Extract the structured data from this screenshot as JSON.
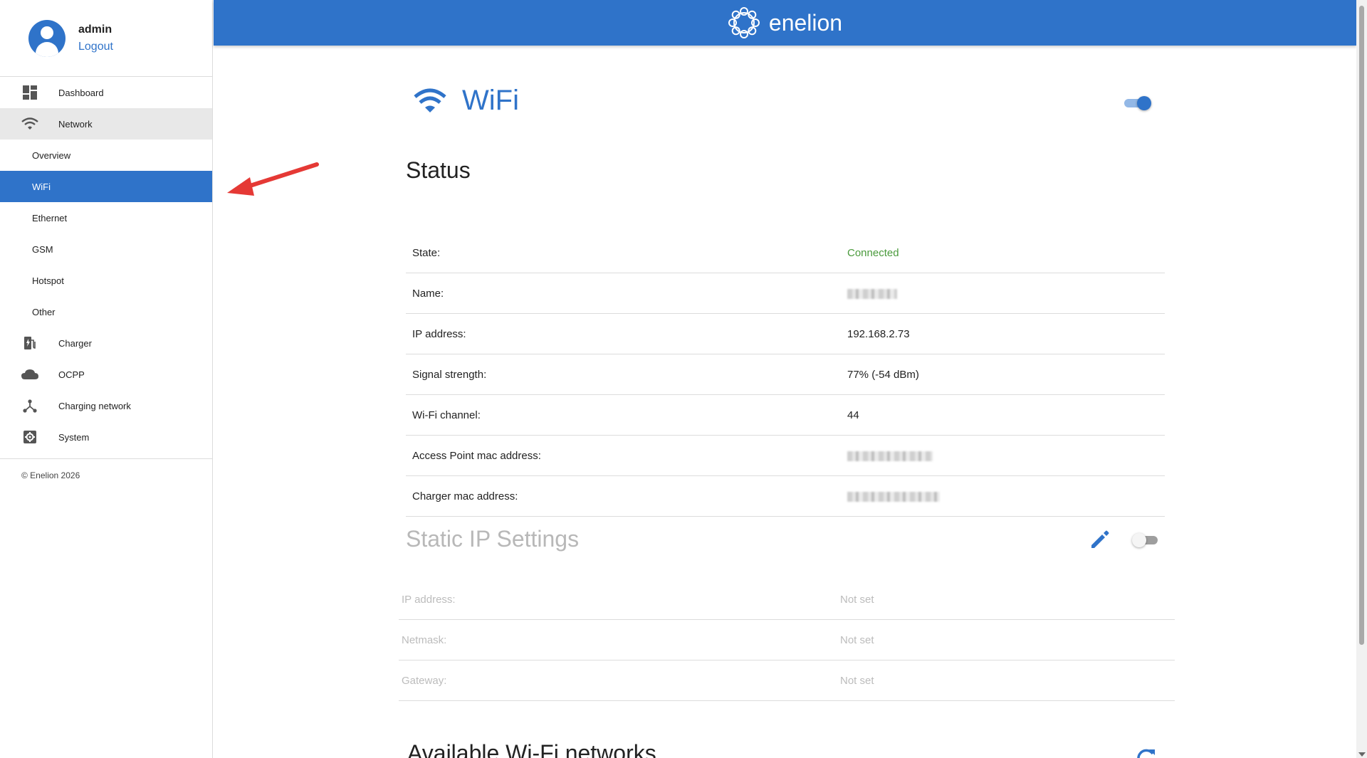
{
  "user": {
    "name": "admin",
    "logout_label": "Logout"
  },
  "sidebar": {
    "items": [
      {
        "label": "Dashboard",
        "icon": "dashboard-icon"
      },
      {
        "label": "Network",
        "icon": "wifi-icon"
      },
      {
        "label": "Charger",
        "icon": "charger-icon"
      },
      {
        "label": "OCPP",
        "icon": "cloud-icon"
      },
      {
        "label": "Charging network",
        "icon": "network-icon"
      },
      {
        "label": "System",
        "icon": "settings-icon"
      }
    ],
    "network_sub": [
      "Overview",
      "WiFi",
      "Ethernet",
      "GSM",
      "Hotspot",
      "Other"
    ],
    "footer": "© Enelion 2026"
  },
  "header": {
    "brand": "enelion"
  },
  "page": {
    "title": "WiFi",
    "wifi_enabled": true,
    "status": {
      "title": "Status",
      "rows": [
        {
          "label": "State:",
          "value": "Connected"
        },
        {
          "label": "Name:",
          "value": ""
        },
        {
          "label": "IP address:",
          "value": "192.168.2.73"
        },
        {
          "label": "Signal strength:",
          "value": "77% (-54 dBm)"
        },
        {
          "label": "Wi-Fi channel:",
          "value": "44"
        },
        {
          "label": "Access Point mac address:",
          "value": ""
        },
        {
          "label": "Charger mac address:",
          "value": ""
        }
      ]
    },
    "static_ip": {
      "title": "Static IP Settings",
      "enabled": false,
      "rows": [
        {
          "label": "IP address:",
          "value": "Not set"
        },
        {
          "label": "Netmask:",
          "value": "Not set"
        },
        {
          "label": "Gateway:",
          "value": "Not set"
        }
      ]
    },
    "available_title": "Available Wi-Fi networks"
  },
  "colors": {
    "primary": "#2f73c9",
    "connected": "#4a9a3c",
    "disabled_text": "#bcbcbc",
    "annotation_arrow": "#e53935"
  }
}
